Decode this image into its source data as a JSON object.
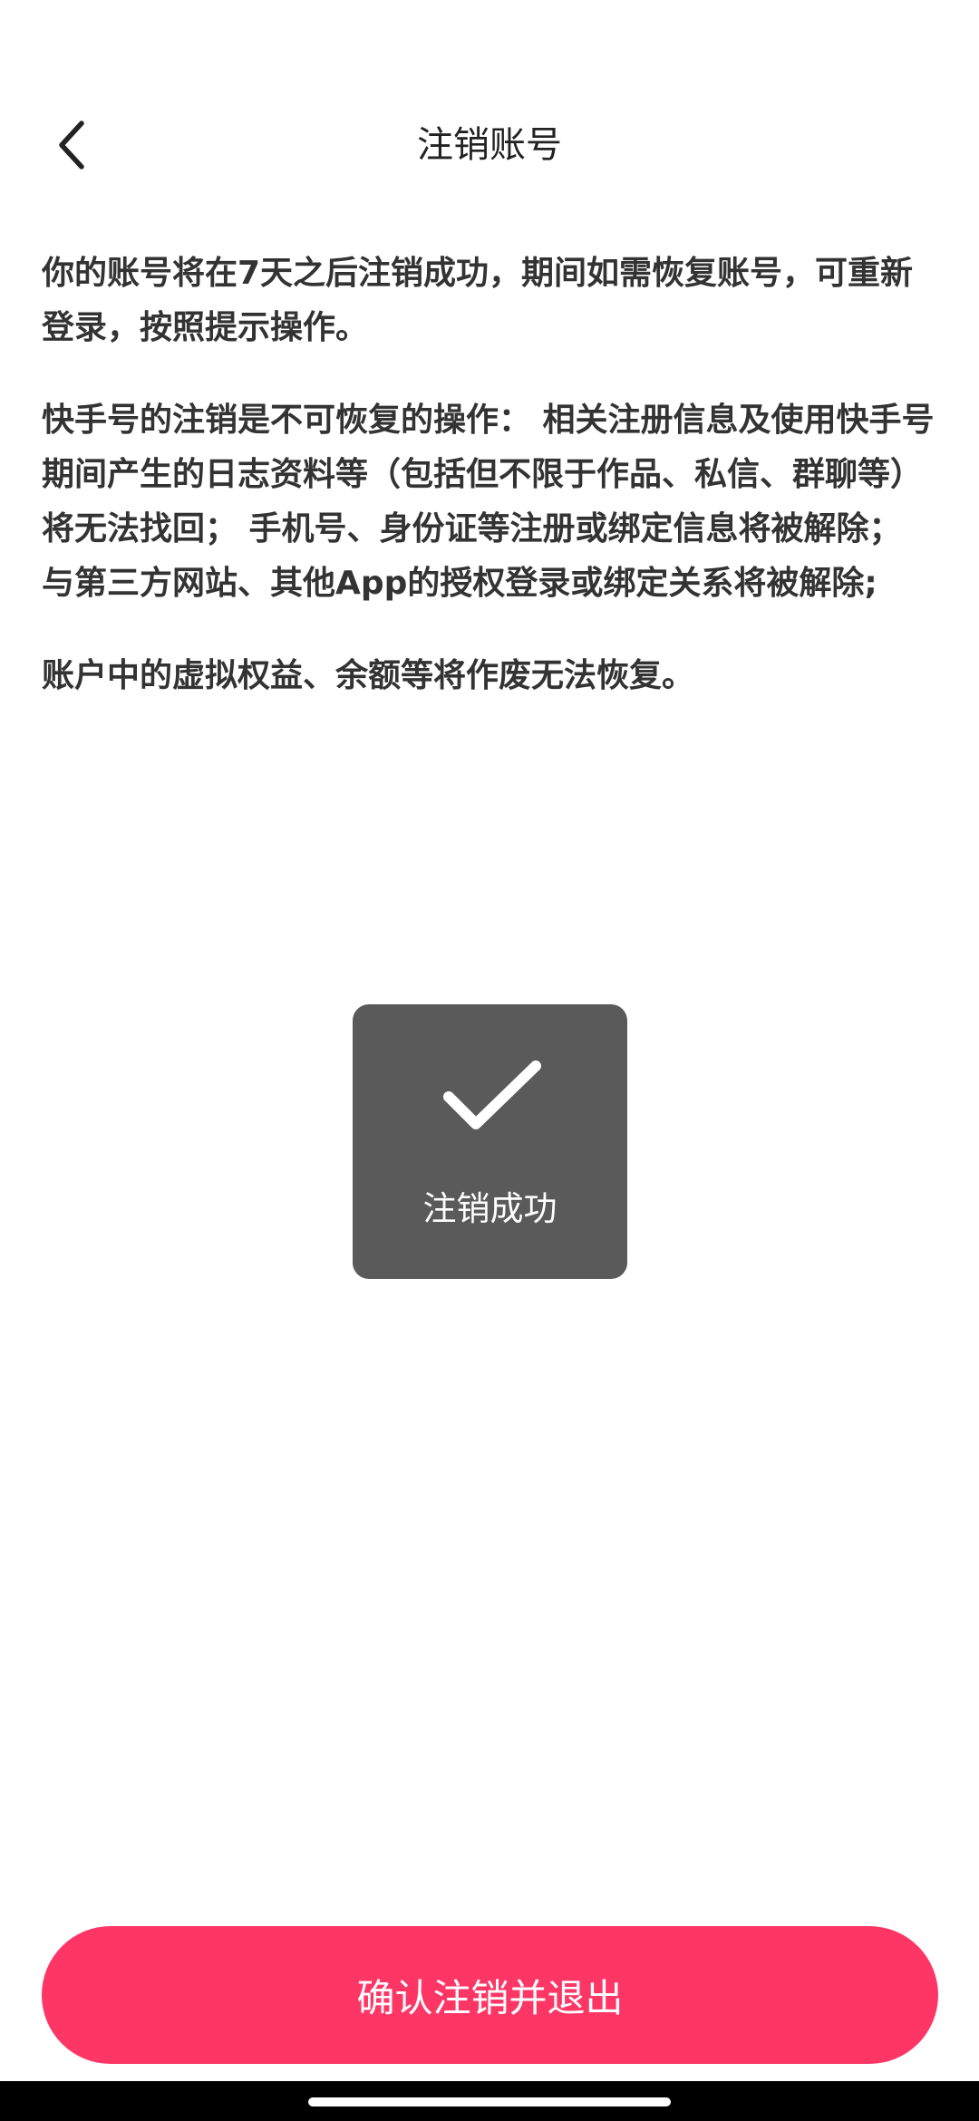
{
  "header": {
    "title": "注销账号",
    "back_icon": "chevron-left-icon"
  },
  "content": {
    "paragraphs": [
      "你的账号将在7天之后注销成功，期间如需恢复账号，可重新登录，按照提示操作。",
      "快手号的注销是不可恢复的操作： 相关注册信息及使用快手号期间产生的日志资料等（包括但不限于作品、私信、群聊等）将无法找回； 手机号、身份证等注册或绑定信息将被解除； 与第三方网站、其他App的授权登录或绑定关系将被解除;",
      "账户中的虚拟权益、余额等将作废无法恢复。"
    ]
  },
  "toast": {
    "icon": "checkmark-icon",
    "label": "注销成功"
  },
  "footer": {
    "confirm_label": "确认注销并退出"
  },
  "colors": {
    "accent": "#fe3666",
    "toast_bg": "#5a5a5a",
    "text": "#333333"
  }
}
